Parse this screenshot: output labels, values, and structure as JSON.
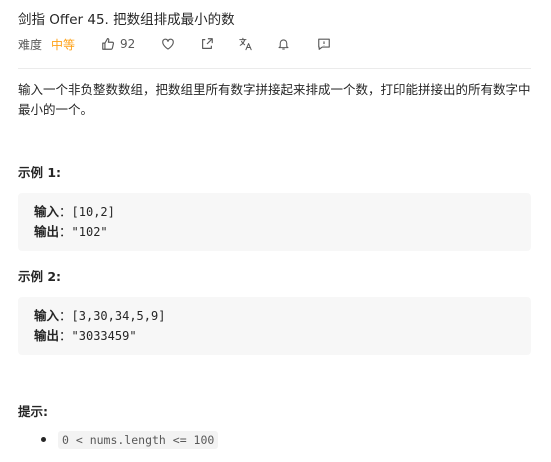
{
  "problem": {
    "title": "剑指 Offer 45. 把数组排成最小的数",
    "difficulty_label": "难度",
    "difficulty": "中等",
    "likes": "92",
    "difficulty_color": "#ffa116",
    "icons": [
      "thumbs-up-icon",
      "heart-icon",
      "share-icon",
      "translate-icon",
      "bell-icon",
      "feedback-icon"
    ]
  },
  "description": "输入一个非负整数数组，把数组里所有数字拼接起来排成一个数，打印能拼接出的所有数字中最小的一个。",
  "examples": [
    {
      "title": "示例 1:",
      "input_label": "输入",
      "input_colon": "：",
      "input": "[10,2]",
      "output_label": "输出",
      "output_colon": "：",
      "output": "\"102\""
    },
    {
      "title": "示例 2:",
      "input_label": "输入",
      "input_colon": "：",
      "input": "[3,30,34,5,9]",
      "output_label": "输出",
      "output_colon": "：",
      "output": "\"3033459\""
    }
  ],
  "tips": {
    "title": "提示:",
    "items": [
      "0 < nums.length <= 100"
    ]
  }
}
